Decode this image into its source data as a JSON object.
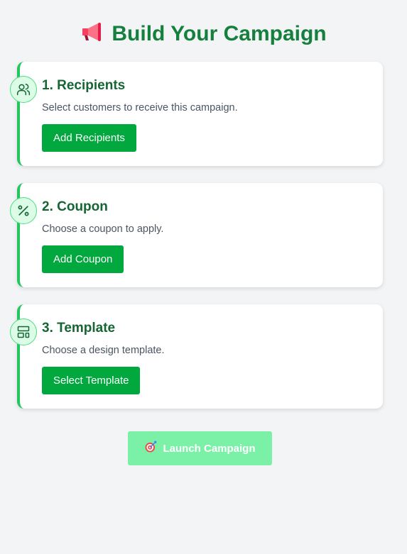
{
  "title": {
    "text": "Build Your Campaign",
    "icon": "megaphone-icon"
  },
  "steps": [
    {
      "title": "1. Recipients",
      "description": "Select customers to receive this campaign.",
      "button_label": "Add Recipients",
      "icon": "users-icon"
    },
    {
      "title": "2. Coupon",
      "description": "Choose a coupon to apply.",
      "button_label": "Add Coupon",
      "icon": "percent-icon"
    },
    {
      "title": "3. Template",
      "description": "Choose a design template.",
      "button_label": "Select Template",
      "icon": "layout-template-icon"
    }
  ],
  "launch": {
    "label": "Launch Campaign",
    "icon": "target-icon",
    "disabled": true
  },
  "colors": {
    "accent": "#22c55e",
    "title": "#15803d",
    "button": "#00a83e",
    "launch_disabled": "#7bf1a8",
    "background": "#f3f4f6"
  }
}
